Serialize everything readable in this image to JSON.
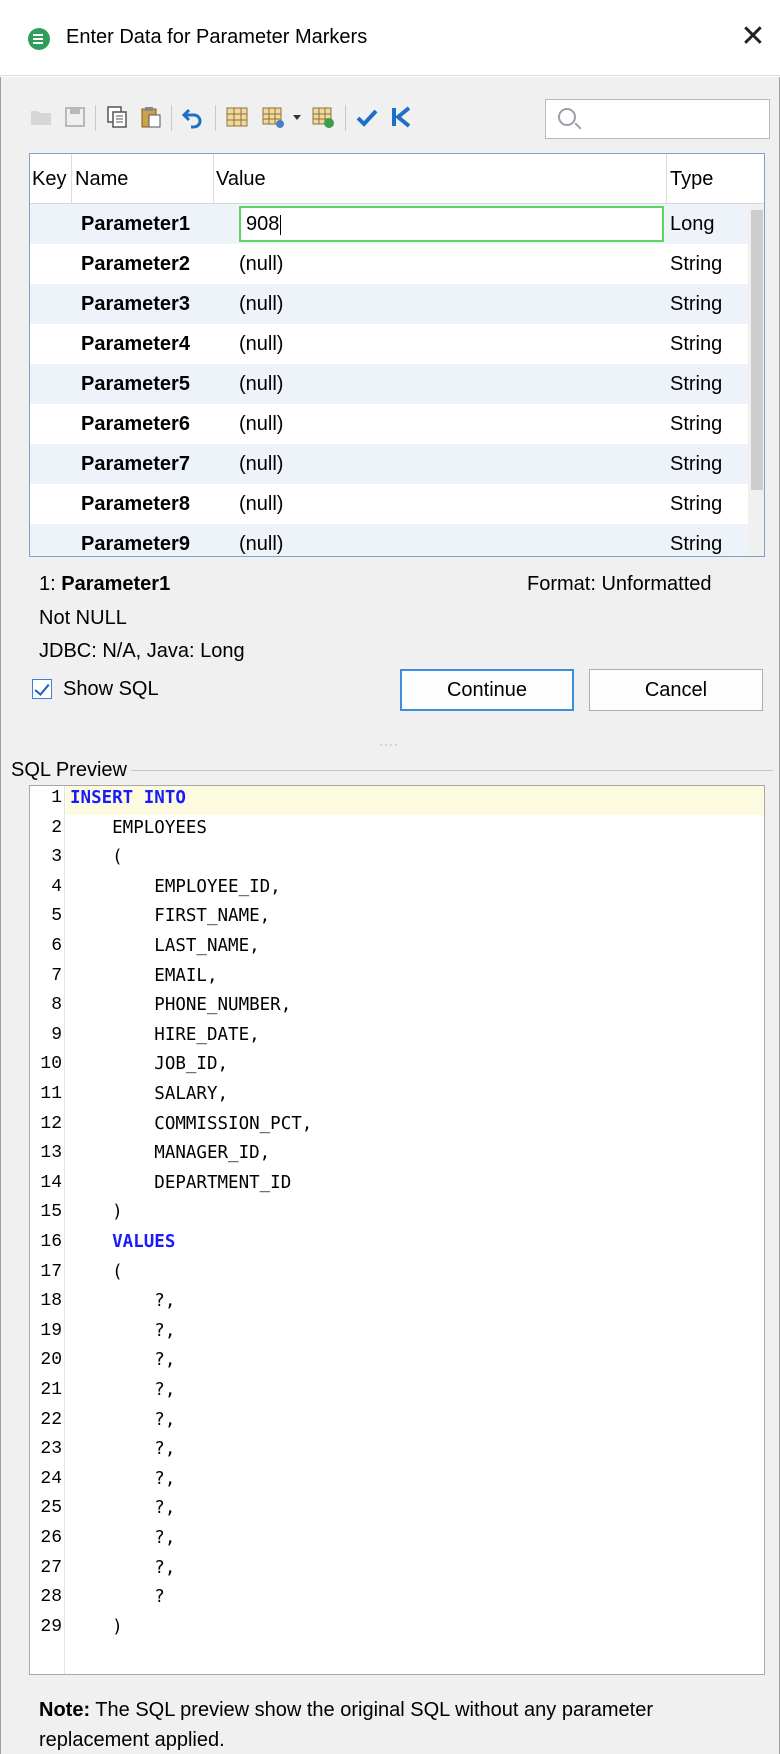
{
  "window": {
    "title": "Enter Data for Parameter Markers",
    "close_icon": "✕"
  },
  "toolbar": {
    "icons": [
      "open-folder-icon",
      "save-icon",
      "copy-icon",
      "paste-icon",
      "undo-icon",
      "grid-icon",
      "grid-settings-icon",
      "grid-check-icon",
      "check-icon",
      "first-record-icon"
    ],
    "search_placeholder": ""
  },
  "grid": {
    "headers": {
      "key": "Key",
      "name": "Name",
      "value": "Value",
      "type": "Type"
    },
    "rows": [
      {
        "name": "Parameter1",
        "value": "908",
        "type": "Long"
      },
      {
        "name": "Parameter2",
        "value": "(null)",
        "type": "String"
      },
      {
        "name": "Parameter3",
        "value": "(null)",
        "type": "String"
      },
      {
        "name": "Parameter4",
        "value": "(null)",
        "type": "String"
      },
      {
        "name": "Parameter5",
        "value": "(null)",
        "type": "String"
      },
      {
        "name": "Parameter6",
        "value": "(null)",
        "type": "String"
      },
      {
        "name": "Parameter7",
        "value": "(null)",
        "type": "String"
      },
      {
        "name": "Parameter8",
        "value": "(null)",
        "type": "String"
      },
      {
        "name": "Parameter9",
        "value": "(null)",
        "type": "String"
      }
    ]
  },
  "details": {
    "index": "1:",
    "param_name": "Parameter1",
    "format": "Format: Unformatted",
    "nullability": "Not NULL",
    "jdbc": "JDBC: N/A, Java: Long"
  },
  "actions": {
    "show_sql_label": "Show SQL",
    "show_sql_checked": true,
    "continue_label": "Continue",
    "cancel_label": "Cancel"
  },
  "sql_preview": {
    "label": "SQL Preview",
    "lines": [
      {
        "n": "1",
        "text": "INSERT INTO",
        "kw": true
      },
      {
        "n": "2",
        "text": "    EMPLOYEES"
      },
      {
        "n": "3",
        "text": "    ("
      },
      {
        "n": "4",
        "text": "        EMPLOYEE_ID,"
      },
      {
        "n": "5",
        "text": "        FIRST_NAME,"
      },
      {
        "n": "6",
        "text": "        LAST_NAME,"
      },
      {
        "n": "7",
        "text": "        EMAIL,"
      },
      {
        "n": "8",
        "text": "        PHONE_NUMBER,"
      },
      {
        "n": "9",
        "text": "        HIRE_DATE,"
      },
      {
        "n": "10",
        "text": "        JOB_ID,"
      },
      {
        "n": "11",
        "text": "        SALARY,"
      },
      {
        "n": "12",
        "text": "        COMMISSION_PCT,"
      },
      {
        "n": "13",
        "text": "        MANAGER_ID,"
      },
      {
        "n": "14",
        "text": "        DEPARTMENT_ID"
      },
      {
        "n": "15",
        "text": "    )"
      },
      {
        "n": "16",
        "text": "    VALUES",
        "kw": true
      },
      {
        "n": "17",
        "text": "    ("
      },
      {
        "n": "18",
        "text": "        ?,"
      },
      {
        "n": "19",
        "text": "        ?,"
      },
      {
        "n": "20",
        "text": "        ?,"
      },
      {
        "n": "21",
        "text": "        ?,"
      },
      {
        "n": "22",
        "text": "        ?,"
      },
      {
        "n": "23",
        "text": "        ?,"
      },
      {
        "n": "24",
        "text": "        ?,"
      },
      {
        "n": "25",
        "text": "        ?,"
      },
      {
        "n": "26",
        "text": "        ?,"
      },
      {
        "n": "27",
        "text": "        ?,"
      },
      {
        "n": "28",
        "text": "        ?"
      },
      {
        "n": "29",
        "text": "    )"
      }
    ]
  },
  "note": {
    "bold": "Note:",
    "text": " The SQL preview show the original SQL without any parameter replacement applied."
  }
}
